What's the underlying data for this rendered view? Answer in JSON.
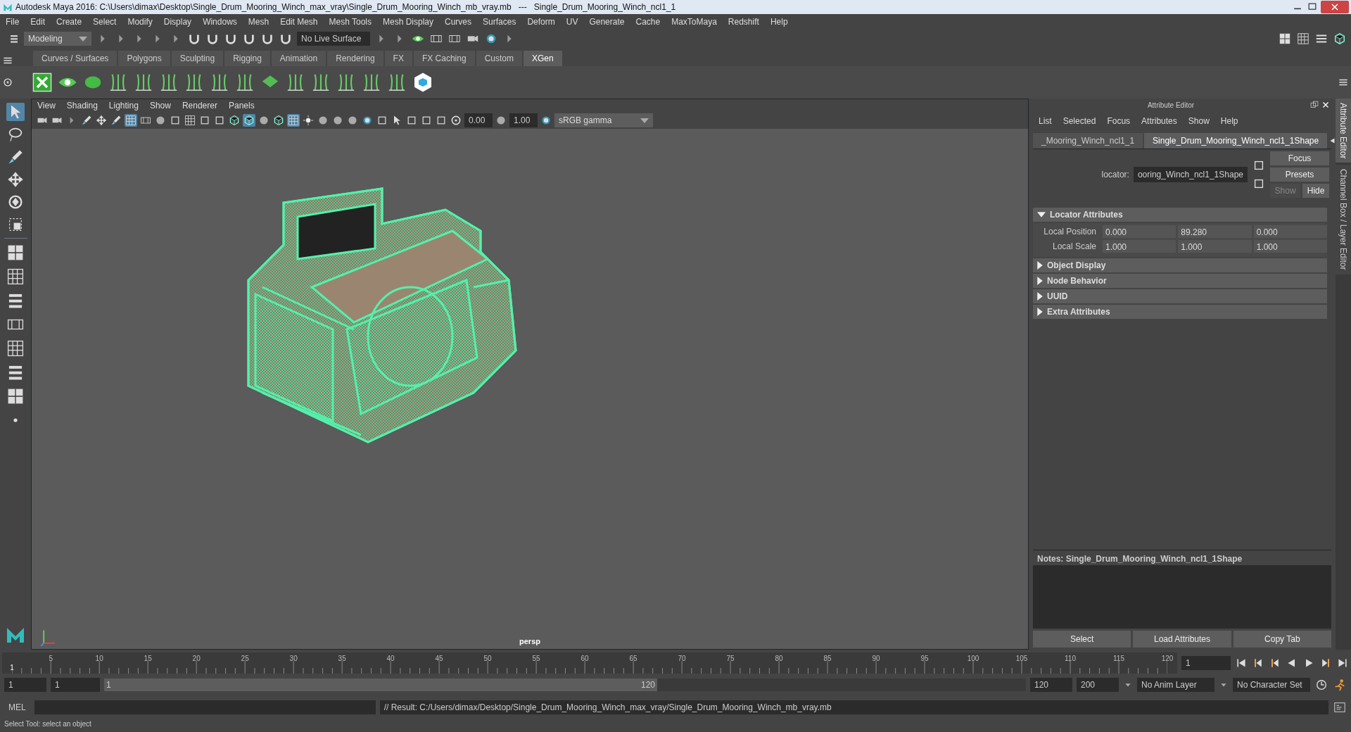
{
  "window": {
    "title": "Autodesk Maya 2016: C:\\Users\\dimax\\Desktop\\Single_Drum_Mooring_Winch_max_vray\\Single_Drum_Mooring_Winch_mb_vray.mb   ---   Single_Drum_Mooring_Winch_ncl1_1"
  },
  "menu": [
    "File",
    "Edit",
    "Create",
    "Select",
    "Modify",
    "Display",
    "Windows",
    "Mesh",
    "Edit Mesh",
    "Mesh Tools",
    "Mesh Display",
    "Curves",
    "Surfaces",
    "Deform",
    "UV",
    "Generate",
    "Cache",
    "MaxToMaya",
    "Redshift",
    "Help"
  ],
  "status_line": {
    "mode": "Modeling",
    "live_surface": "No Live Surface"
  },
  "shelf": {
    "tabs": [
      {
        "label": "Curves / Surfaces",
        "selected": false
      },
      {
        "label": "Polygons",
        "selected": false
      },
      {
        "label": "Sculpting",
        "selected": false
      },
      {
        "label": "Rigging",
        "selected": false
      },
      {
        "label": "Animation",
        "selected": false
      },
      {
        "label": "Rendering",
        "selected": false
      },
      {
        "label": "FX",
        "selected": false
      },
      {
        "label": "FX Caching",
        "selected": false
      },
      {
        "label": "Custom",
        "selected": false
      },
      {
        "label": "XGen",
        "selected": true
      }
    ]
  },
  "toolbox": {
    "tools": [
      {
        "selected": true
      },
      {
        "selected": false
      },
      {
        "selected": false
      },
      {
        "selected": false
      },
      {
        "selected": false
      },
      {
        "selected": false
      }
    ]
  },
  "viewport": {
    "menu": [
      "View",
      "Shading",
      "Lighting",
      "Show",
      "Renderer",
      "Panels"
    ],
    "toggles": [
      {
        "on": false
      },
      {
        "on": false
      },
      {
        "on": false
      },
      {
        "on": false
      },
      {
        "on": false
      },
      {
        "on": false
      },
      {
        "on": true
      },
      {
        "on": false
      },
      {
        "on": false
      },
      {
        "on": false
      },
      {
        "on": false
      },
      {
        "on": false
      },
      {
        "on": false
      },
      {
        "on": false
      },
      {
        "on": true
      },
      {
        "on": false
      },
      {
        "on": false
      },
      {
        "on": true
      },
      {
        "on": false
      },
      {
        "on": false
      },
      {
        "on": false
      },
      {
        "on": false
      },
      {
        "on": false
      },
      {
        "on": false
      },
      {
        "on": false
      },
      {
        "on": false
      },
      {
        "on": false
      },
      {
        "on": false
      }
    ],
    "exposure": "0.00",
    "gamma": "1.00",
    "color_space": "sRGB gamma",
    "camera": "persp"
  },
  "attribute_editor": {
    "title": "Attribute Editor",
    "menu": [
      "List",
      "Selected",
      "Focus",
      "Attributes",
      "Show",
      "Help"
    ],
    "tabs": [
      {
        "label": "_Mooring_Winch_ncl1_1",
        "selected": false
      },
      {
        "label": "Single_Drum_Mooring_Winch_ncl1_1Shape",
        "selected": true
      }
    ],
    "node_label": "locator:",
    "node_name": "ooring_Winch_ncl1_1Shape",
    "side_buttons": [
      {
        "label": "Focus",
        "disabled": false
      },
      {
        "label": "Presets",
        "disabled": false
      }
    ],
    "show_hide": [
      {
        "label": "Show",
        "disabled": true
      },
      {
        "label": "Hide",
        "disabled": false
      }
    ],
    "sections": [
      {
        "title": "Locator Attributes",
        "expanded": true,
        "rows": [
          {
            "label": "Local Position",
            "values": [
              "0.000",
              "89.280",
              "0.000"
            ]
          },
          {
            "label": "Local Scale",
            "values": [
              "1.000",
              "1.000",
              "1.000"
            ]
          }
        ]
      },
      {
        "title": "Object Display",
        "expanded": false
      },
      {
        "title": "Node Behavior",
        "expanded": false
      },
      {
        "title": "UUID",
        "expanded": false
      },
      {
        "title": "Extra Attributes",
        "expanded": false
      }
    ],
    "notes": "Notes:  Single_Drum_Mooring_Winch_ncl1_1Shape",
    "buttons": [
      "Select",
      "Load Attributes",
      "Copy Tab"
    ]
  },
  "side_tabs": [
    {
      "label": "Attribute Editor",
      "selected": true
    },
    {
      "label": "Channel Box / Layer Editor",
      "selected": false
    }
  ],
  "timeline": {
    "start": "1",
    "labels": [
      "5",
      "10",
      "15",
      "20",
      "25",
      "30",
      "35",
      "40",
      "45",
      "50",
      "55",
      "60",
      "65",
      "70",
      "75",
      "80",
      "85",
      "90",
      "95",
      "100",
      "105",
      "110",
      "115",
      "120"
    ],
    "current_frame": "1"
  },
  "range": {
    "level": 0.6,
    "start": "1",
    "inner_start": "1",
    "slider_start": "1",
    "slider_end": "120",
    "inner_end": "120",
    "end": "200",
    "anim_layer": "No Anim Layer",
    "character_set": "No Character Set"
  },
  "command_line": {
    "language": "MEL",
    "result": "// Result: C:/Users/dimax/Desktop/Single_Drum_Mooring_Winch_max_vray/Single_Drum_Mooring_Winch_mb_vray.mb"
  },
  "help_line": "Select Tool: select an object"
}
